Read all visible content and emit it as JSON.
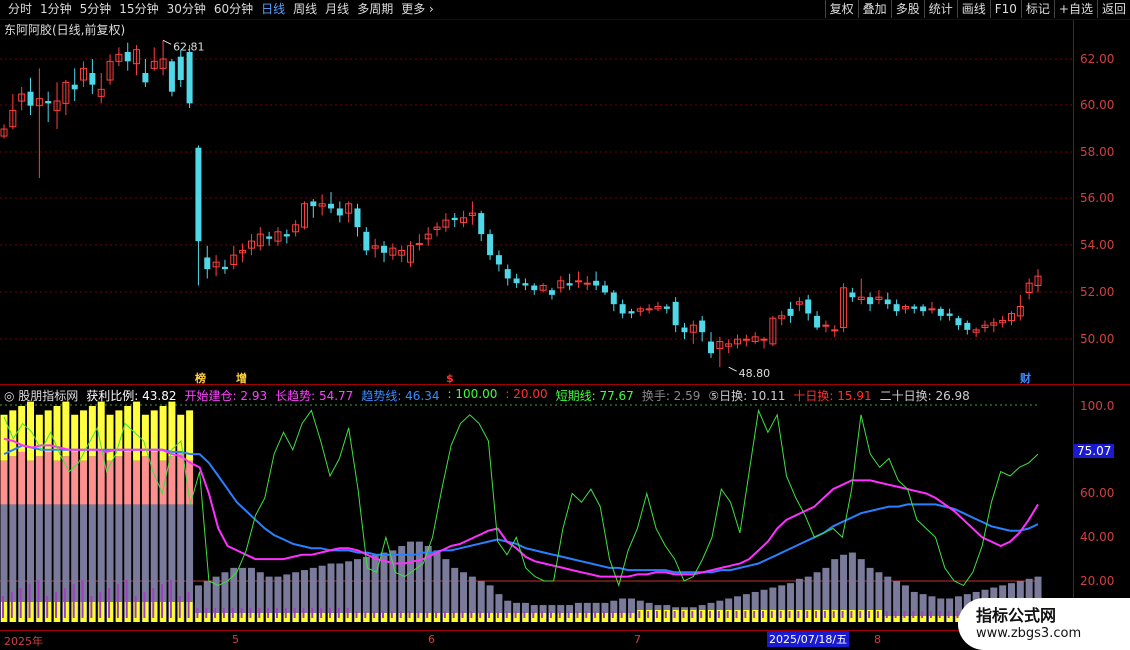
{
  "toolbar": {
    "periods": [
      "分时",
      "1分钟",
      "5分钟",
      "15分钟",
      "30分钟",
      "60分钟",
      "日线",
      "周线",
      "月线",
      "多周期",
      "更多"
    ],
    "active": "日线",
    "right_buttons": [
      "复权",
      "叠加",
      "多股",
      "统计",
      "画线",
      "F10",
      "标记",
      "+自选",
      "返回"
    ]
  },
  "stock": {
    "title": "东阿阿胶(日线,前复权)",
    "high_label": "62.81",
    "low_label": "48.80"
  },
  "price_axis": [
    "62.00",
    "60.00",
    "58.00",
    "56.00",
    "54.00",
    "52.00",
    "50.00"
  ],
  "indicator": {
    "name": "股朋指标网",
    "items": [
      {
        "label": "获利比例:",
        "value": "43.82",
        "color": "#ffffff"
      },
      {
        "label": "开始建仓:",
        "value": "2.93",
        "color": "#ff40ff"
      },
      {
        "label": "长趋势:",
        "value": "54.77",
        "color": "#ff40ff"
      },
      {
        "label": "趋势线:",
        "value": "46.34",
        "color": "#3a8cff"
      },
      {
        "label": ":",
        "value": "100.00",
        "color": "#40ff40"
      },
      {
        "label": ":",
        "value": "20.00",
        "color": "#ff3030"
      },
      {
        "label": "短期线:",
        "value": "77.67",
        "color": "#40ff40"
      },
      {
        "label": "换手:",
        "value": "2.59",
        "color": "#888888"
      },
      {
        "label": "⑤日换:",
        "value": "10.11",
        "color": "#cccccc"
      },
      {
        "label": "十日换:",
        "value": "15.91",
        "color": "#ff3030"
      },
      {
        "label": "二十日换:",
        "value": "26.98",
        "color": "#cccccc"
      }
    ],
    "axis": [
      "100.0",
      "80.00",
      "60.00",
      "40.00",
      "20.00"
    ],
    "current_value": "75.07"
  },
  "markers": [
    "榜",
    "增",
    "$",
    "财"
  ],
  "dates": {
    "year": "2025年",
    "months": [
      "5",
      "6",
      "7",
      "8"
    ],
    "cursor": "2025/07/18/五"
  },
  "watermark": {
    "title": "指标公式网",
    "url": "www.zbgs3.com"
  },
  "colors": {
    "up": "#ff4040",
    "down": "#4fd8e8",
    "grid": "#8a0000"
  }
}
